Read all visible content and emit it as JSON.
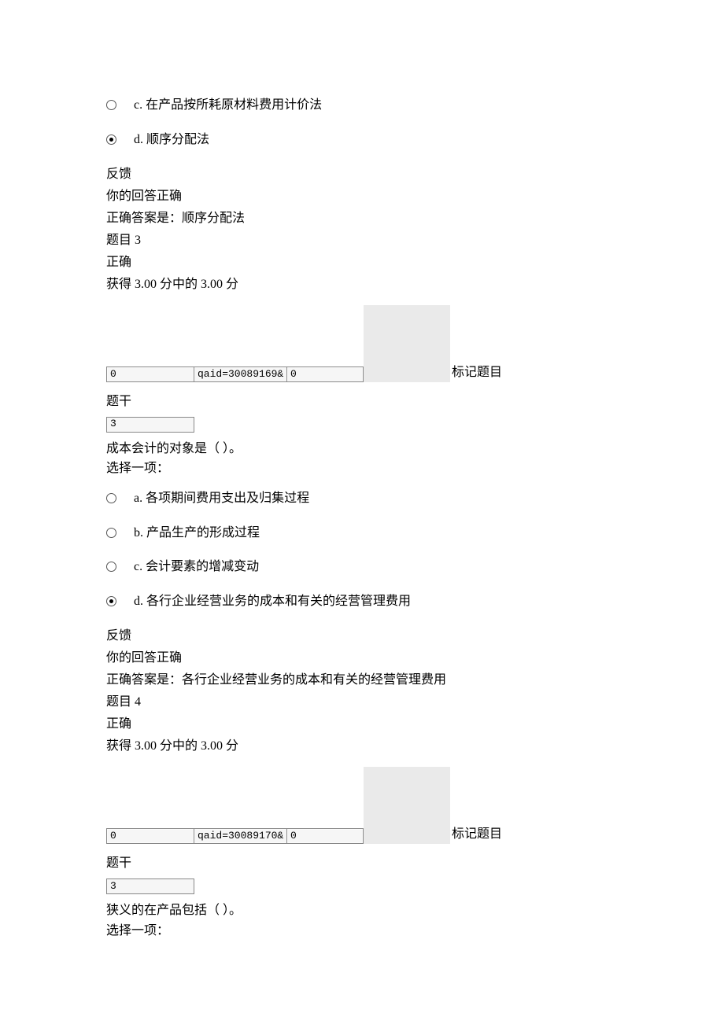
{
  "q2_tail": {
    "options": [
      {
        "letter": "c.",
        "text": "在产品按所耗原材料费用计价法",
        "selected": false
      },
      {
        "letter": "d.",
        "text": "顺序分配法",
        "selected": true
      }
    ],
    "feedback_title": "反馈",
    "feedback_line1": "你的回答正确",
    "feedback_line2": "正确答案是：顺序分配法",
    "next_title": "题目 3",
    "next_status": "正确",
    "next_score": "获得 3.00 分中的 3.00 分"
  },
  "q3": {
    "inputs": {
      "a": "0",
      "b": "qaid=30089169&",
      "c": "0"
    },
    "mark_label": "标记题目",
    "section_title": "题干",
    "small_input": "3",
    "question": "成本会计的对象是（ ）。",
    "choose": "选择一项：",
    "options": [
      {
        "letter": "a.",
        "text": "各项期间费用支出及归集过程",
        "selected": false
      },
      {
        "letter": "b.",
        "text": "产品生产的形成过程",
        "selected": false
      },
      {
        "letter": "c.",
        "text": "会计要素的增减变动",
        "selected": false
      },
      {
        "letter": "d.",
        "text": "各行企业经营业务的成本和有关的经营管理费用",
        "selected": true
      }
    ],
    "feedback_title": "反馈",
    "feedback_line1": "你的回答正确",
    "feedback_line2": "正确答案是：各行企业经营业务的成本和有关的经营管理费用",
    "next_title": "题目 4",
    "next_status": "正确",
    "next_score": "获得 3.00 分中的 3.00 分"
  },
  "q4": {
    "inputs": {
      "a": "0",
      "b": "qaid=30089170&",
      "c": "0"
    },
    "mark_label": "标记题目",
    "section_title": "题干",
    "small_input": "3",
    "question": "狭义的在产品包括（ ）。",
    "choose": "选择一项："
  }
}
